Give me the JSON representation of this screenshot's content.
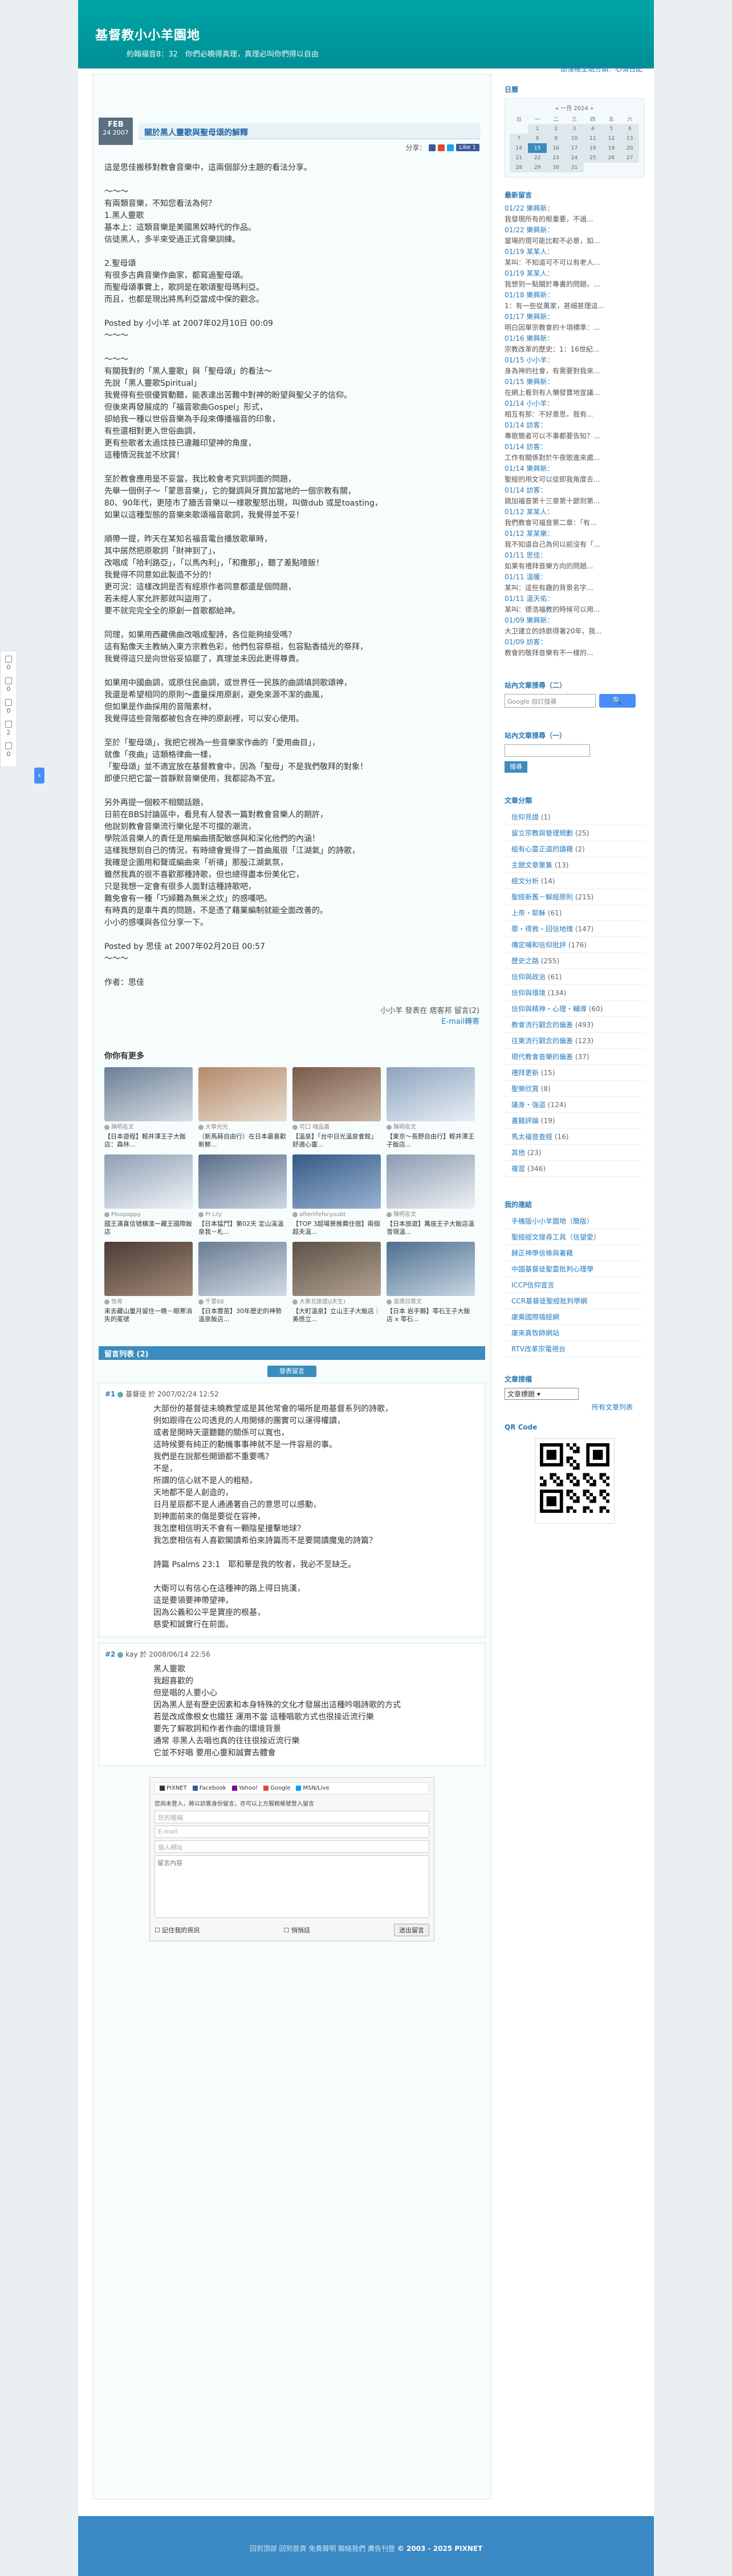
{
  "blog": {
    "title": "基督教小小羊園地",
    "subtitle": "約翰福音8：32　你們必曉得真理，真理必叫你們得以自由",
    "toplinks": "部落格全站分類：心情日記"
  },
  "post": {
    "month": "FEB",
    "day": "24",
    "year": "2007",
    "title": "關於黑人靈歌與聖母頌的解釋",
    "share_label": "分享：",
    "like": "Like 1",
    "paragraphs": [
      "這是思佳搬移對教會音樂中，這兩個部分主題的看法分享。",
      "～～～\n有兩類音樂，不知您看法為何？\n1.黑人靈歌\n基本上：這類音樂是美國黑奴時代的作品。\n信徒黑人，多半來受過正式音樂訓練。",
      "2.聖母頌\n有很多古典音樂作曲家，都寫過聖母頌。\n而聖母頌事實上，歌詞是在歌頌聖母瑪利亞。\n而且，也都是現出將馬利亞當成中保的觀念。",
      "Posted by 小小羊 at 2007年02月10日 00:09\n～～～",
      "～～～\n有關我對的「黑人靈歌」與「聖母頌」的看法～\n先說「黑人靈歌Spiritual」\n我覺得有些很優質動聽，能表達出苦難中對神的盼望與聖父子的信仰。\n但後來再發展成的「福音歌曲Gospel」形式，\n卻給我一種以世俗音樂為手段來傳播福音的印象，\n有些還相對更入世俗曲調，\n更有些歌者太過炫技已違離印望神的角度，\n這種情況我並不欣賞！",
      "至於教會應用是不妥當，我比較會考究到詞面的問題，\n先舉一個例子～「蒙恩音樂」，它的聲調與牙買加當地的一個宗教有關，\n80、90年代，更陸市了牆舌音樂以一樣歌聖怒出現，叫做dub 或是toasting，\n如果以這種型態的音樂來歌頌福音歌詞，我覺得並不妥！",
      "順帶一提，昨天在某知名福音電台播放歌單時，\n其中居然把原歌詞「財神到了」，\n改唱成「哈利路亞」，「以馬內利」，「和撒那」，聽了差點噎飯！\n我覺得不同意如此製造不分的！\n更可況：這樣改詞是否有經原作者同意都還是個問題，\n若未經人家允許那就叫盜用了，\n要不就完完全全的原創一首歌都給神。",
      "同理，如果用西藏佛曲改唱成聖詩，各位能夠接受嗎？\n這有點像天主教納入東方宗教色彩，他們包容祭祖，包容點香插光的祭拜，\n我覺得這只是向世俗妥協罷了，真理並未因此更得尊貴。",
      "如果用中國曲調，或原住民曲調，或世界任一民族的曲調填詞歌頌神，\n我還是希望相同的原則～盡量採用原創，避免來源不潔的曲風，\n但如果是作曲採用的音階素材，\n我覺得這些音階都被包含在神的原創裡，可以安心使用。",
      "至於「聖母頌」，我把它視為一些音樂家作曲的「愛用曲目」，\n就像「夜曲」這類格律曲一樣，\n「聖母頌」並不適宜放在基督教會中，因為「聖母」不是我們敬拜的對象！\n即便只把它當一首靜默音樂使用，我都認為不宜。",
      "另外再提一個較不相關話題，\n日前在BBS討論區中，看見有人發表一篇對教會音樂人的期許，\n他說到教會音樂流行樂化是不可擋的潮流，\n學院派音樂人的責任是用編曲搭配敏感與和深化他們的內涵！\n這樣我想到自己的情況，有時總會覺得了一首曲風很「江湖氣」的詩歌，\n我確是企圖用和聲或編曲來「祈禱」那股江湖氣氛，\n雖然我真的很不喜歡那種詩歌，但也總得盡本份美化它，\n只是我想一定會有很多人面對這種詩歌吧，\n難免會有一種「巧婦難為無米之炊」的感嘆吧。\n有時真的是車牛真的問題，不是憑了藉業編制就能全面改善的。\n小小的感嘆與各位分享一下。",
      "Posted by 思佳 at 2007年02月20日 00:57\n～～～",
      "作者：思佳"
    ],
    "footer_line1": "小小羊 發表在 痞客邦 留言(2)",
    "footer_line2": "E-mail轉寄"
  },
  "related": {
    "title": "你你有更多",
    "items": [
      {
        "author": "陳明名文",
        "title": "【日本遊程】輕井澤王子大飯店：森林..."
      },
      {
        "author": "大箏光光",
        "title": "（新馬蒔自由行）在日本最喜歡新鮮..."
      },
      {
        "author": "可口 嗨品嘉",
        "title": "【溫泉】「台中日光溫泉會館」舒適心靈..."
      },
      {
        "author": "陳明名文",
        "title": "【東京～長野自由行】輕井澤王子飯店..."
      },
      {
        "author": "Ploopappy",
        "title": "國王滿喜信號橫濱ー藏王國際飯店"
      },
      {
        "author": "PI Lily",
        "title": "【日本猛鬥】第02天 定山溪溫泉我－札..."
      },
      {
        "author": "afterlifeforyoubt",
        "title": "【TOP 3超場景推薦住宿】兩個超夫溫..."
      },
      {
        "author": "陳明名文",
        "title": "【日本旅遊】萬座王子大飯店溫雪嶺溫..."
      },
      {
        "author": "恰肯",
        "title": "來去藏山量月留住一晚－眼寒消失的冕號"
      },
      {
        "author": "千里88",
        "title": "【日本豐苗】30年歷史的神勢溫泉飯店..."
      },
      {
        "author": "大東北旅遊(J天生)",
        "title": "【大町溫泉】立山王子大飯店｜美感立..."
      },
      {
        "author": "滋潤日英文",
        "title": "【日本 岩手縣】零石王子大飯店 x 零石..."
      }
    ]
  },
  "comments": {
    "header": "留言列表 (2)",
    "add_button": "發表留言",
    "list": [
      {
        "num": "#1",
        "author": "基督徒",
        "date": "於 2007/02/24 12:52",
        "body": "大部份的基督徒未曉教堂或是其他常會的場所是用基督系列的詩歌，\n例如跟得在公司透見的人用開條的團實可以運得權讀，\n或者是開時天還聽聽的關係可以寬也，\n這時候要有純正的動機事事神就不是一件容易的事。\n我們是在說那些開頭都不重要嗎？\n不是，\n所謂的信心就不是人的粗糙，\n天地都不是人創造的，\n日月星辰都不是人通通著自己的意思可以感動，\n到神面前來的傷是要從在容神，\n我怎麼相信明天不會有一顆陰星撞擊地球？\n我怎麼相信有人喜歡閣讀希伯來詩篇而不是要閱讀魔鬼的詩篇？\n\n詩篇 Psalms 23:1　耶和華是我的牧者，我必不至缺乏。\n\n大衛可以有信心在這種神的路上得日挑漢，\n這是要領要神帶望神，\n因為公義和公平是寶座的根基，\n慈愛和誠實行在前面。"
      },
      {
        "num": "#2",
        "author": "kay",
        "date": "於 2008/06/14 22:56",
        "body": "黑人靈歌\n我超喜歡的\n但是唱的人要小心\n因為黑人是有歷史因素和本身特殊的文化才發展出這種吟唱詩歌的方式\n若是改成像根女也鐵狂 運用不當 這種唱歌方式也很接近流行樂\n要先了解歌詞和作者作曲的環境背景\n通常 非黑人去唱也真的往往很接近流行樂\n它並不好唱 要用心靈和誠實去體會"
      }
    ]
  },
  "form": {
    "sso": [
      "PIXNET",
      "Facebook",
      "Yahoo!",
      "Google",
      "MSN/Live"
    ],
    "hint": "您尚未登入，將以訪客身份留言，亦可以上方服務帳號登入留言",
    "name_placeholder": "您的暱稱",
    "email_placeholder": "E-mail",
    "url_placeholder": "個人網址",
    "body_placeholder": "留言內容",
    "private": "悄悄話",
    "remember": "記住我的資訊",
    "submit": "送出留言"
  },
  "footer": {
    "links": "回到頂部 回到首頁 免責聲明 聯絡我們 廣告刊登",
    "copy": "© 2003 - 2025 PIXNET"
  },
  "sidebar": {
    "calendar_title": "日曆",
    "calendar_caption": "« 一月 2024 »",
    "calendar_weekdays": [
      "日",
      "一",
      "二",
      "三",
      "四",
      "五",
      "六"
    ],
    "recent_comments_title": "最新留言",
    "recent_comments": [
      {
        "d": "01/22 樂興新：",
        "t": "我發現所有的根重要，不過..."
      },
      {
        "d": "01/22 樂興新：",
        "t": "當場的現可能比較不必意，如..."
      },
      {
        "d": "01/19 某某人：",
        "t": "某叫：不知道可不可以有老人..."
      },
      {
        "d": "01/19 某某人：",
        "t": "我想到一點關於專書的問題，..."
      },
      {
        "d": "01/18 樂興新：",
        "t": "1：有一些從萬家，甚細甚理這..."
      },
      {
        "d": "01/17 樂興新：",
        "t": "明白因單宗教會的十項標準：..."
      },
      {
        "d": "01/16 樂興新：",
        "t": "宗教改革的歷史：1：16世紀..."
      },
      {
        "d": "01/15 小小羊：",
        "t": "身為神的社會，有需要對我來..."
      },
      {
        "d": "01/15 樂興新：",
        "t": "在網上看到有人懶發寶地宣議..."
      },
      {
        "d": "01/14 小小羊：",
        "t": "相互有那：不好意思，我有..."
      },
      {
        "d": "01/14 訪客：",
        "t": "專歌簡者可以不事都要告知？..."
      },
      {
        "d": "01/14 訪客：",
        "t": "工作有關係對於午夜歌進來處..."
      },
      {
        "d": "01/14 樂興新：",
        "t": "聖經的用文可以從即我角度去..."
      },
      {
        "d": "01/14 訪客：",
        "t": "跳加福音第十三章第十節到第..."
      },
      {
        "d": "01/12 某某人：",
        "t": "我們教會可福音第二章：「有..."
      },
      {
        "d": "01/12 某某樂：",
        "t": "我不知道自己為何以前沒有「..."
      },
      {
        "d": "01/11 思佳：",
        "t": "如果有禮拜音樂方向的問題..."
      },
      {
        "d": "01/11 溫暖：",
        "t": "某叫：這些有趣的背景名字..."
      },
      {
        "d": "01/11 溫天佑：",
        "t": "某叫：德浩福教的時候可以用..."
      },
      {
        "d": "01/09 樂興新：",
        "t": "大卫建立的詩歌得著20年，我..."
      },
      {
        "d": "01/09 訪客：",
        "t": "教會的敬拜音樂有不一樣的..."
      }
    ],
    "gsearch_title": "站內文章搜尋（二）",
    "gsearch_placeholder": "Google 自訂搜尋",
    "gsearch_button": "🔍",
    "search_title": "站內文章搜尋（一）",
    "search_button": "搜尋",
    "categories_title": "文章分類",
    "categories": [
      {
        "n": "信仰見證",
        "c": "(1)"
      },
      {
        "n": "留立宗教與管理規劃",
        "c": "(25)"
      },
      {
        "n": "組有心靈正道的讀藉",
        "c": "(2)"
      },
      {
        "n": "主題文章聚集",
        "c": "(13)"
      },
      {
        "n": "經文分析",
        "c": "(14)"
      },
      {
        "n": "聖經新舊－解經原則",
        "c": "(215)"
      },
      {
        "n": "上帝・耶穌",
        "c": "(61)"
      },
      {
        "n": "罪・得救・回信地瑰",
        "c": "(147)"
      },
      {
        "n": "傳定哺和信仰批評",
        "c": "(176)"
      },
      {
        "n": "歷史之路",
        "c": "(255)"
      },
      {
        "n": "信仰與政治",
        "c": "(61)"
      },
      {
        "n": "信仰與環境",
        "c": "(134)"
      },
      {
        "n": "信仰與精神・心理・輔導",
        "c": "(60)"
      },
      {
        "n": "教會流行觀念的偏差",
        "c": "(493)"
      },
      {
        "n": "往東流行觀念的偏差",
        "c": "(123)"
      },
      {
        "n": "現代教會音樂的偏差",
        "c": "(37)"
      },
      {
        "n": "禮拜更新",
        "c": "(15)"
      },
      {
        "n": "聖樂欣賞",
        "c": "(8)"
      },
      {
        "n": "議身・強盜",
        "c": "(124)"
      },
      {
        "n": "書籍評論",
        "c": "(19)"
      },
      {
        "n": "馬太福音查經",
        "c": "(16)"
      },
      {
        "n": "其他",
        "c": "(23)"
      },
      {
        "n": "複習",
        "c": "(346)"
      }
    ],
    "links_title": "我的連結",
    "links": [
      "手機版小小羊園地（簡版）",
      "聖經經文搜尋工具（信望愛）",
      "歸正神學信條與著藉",
      "中國基督徒聖靈批判心理學",
      "ICCP信仰宣言",
      "CCR基督徒聖經批判學網",
      "康乘國際禧經網",
      "康來真牧師網站",
      "RTV改革宗電視台"
    ],
    "archive_title": "文章搜檔",
    "archive_select": "文章標題",
    "archive_link": "所有文章列表",
    "qr_title": "QR Code"
  },
  "floatbar": {
    "counts": [
      "0",
      "0",
      "0",
      "2",
      "0"
    ]
  }
}
